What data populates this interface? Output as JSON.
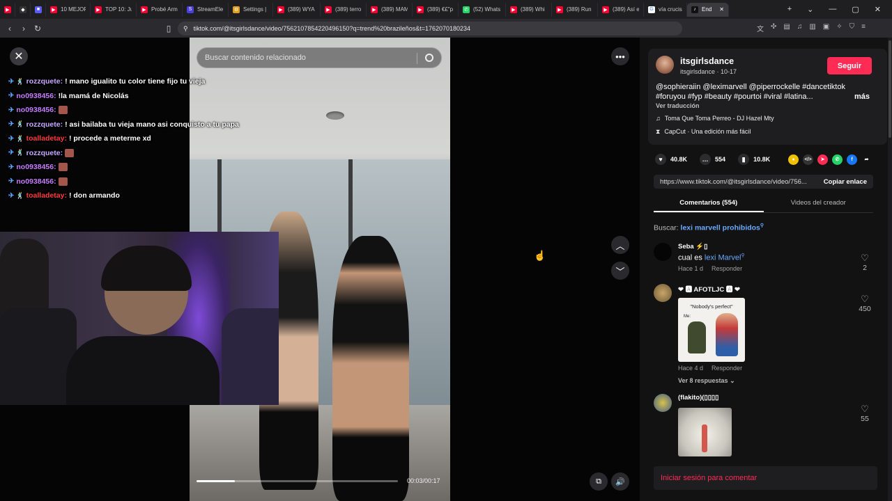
{
  "tabs": [
    {
      "title": "",
      "color": "#ff0033",
      "glyph": "▶"
    },
    {
      "title": "",
      "color": "#333333",
      "glyph": "◆"
    },
    {
      "title": "",
      "color": "#5b5bff",
      "glyph": "■"
    },
    {
      "title": "10 MEJOR",
      "color": "#ff0033",
      "glyph": "▶"
    },
    {
      "title": "TOP 10: Ju",
      "color": "#ff0033",
      "glyph": "▶"
    },
    {
      "title": "Probé Arm",
      "color": "#ff0033",
      "glyph": "▶"
    },
    {
      "title": "StreamEle",
      "color": "#4b3fe0",
      "glyph": "S"
    },
    {
      "title": "Settings |",
      "color": "#e0a020",
      "glyph": "⚙"
    },
    {
      "title": "(389) WYA",
      "color": "#ff0033",
      "glyph": "▶"
    },
    {
      "title": "(389) terro",
      "color": "#ff0033",
      "glyph": "▶"
    },
    {
      "title": "(389) MAM",
      "color": "#ff0033",
      "glyph": "▶"
    },
    {
      "title": "(389) €£\"p",
      "color": "#ff0033",
      "glyph": "▶"
    },
    {
      "title": "(52) Whats",
      "color": "#25d366",
      "glyph": "✆"
    },
    {
      "title": "(389) Whi",
      "color": "#ff0033",
      "glyph": "▶"
    },
    {
      "title": "(389) Run",
      "color": "#ff0033",
      "glyph": "▶"
    },
    {
      "title": "(389) Así e",
      "color": "#ff0033",
      "glyph": "▶"
    },
    {
      "title": "vía crucis",
      "color": "#ffffff",
      "glyph": "G"
    },
    {
      "title": "End",
      "color": "#111111",
      "glyph": "♪",
      "active": true
    }
  ],
  "address": {
    "url": "tiktok.com/@itsgirlsdance/video/7562107854220496150?q=trend%20brazileños&t=1762070180234"
  },
  "video": {
    "search_placeholder": "Buscar contenido relacionado",
    "time": "00:03/00:17",
    "progress": 0.19
  },
  "chat": [
    {
      "user": "rozzquete:",
      "color": "#c9a8ff",
      "msg": "! mano igualito tu color tiene fijo tu vieja",
      "dance": true
    },
    {
      "user": "no0938456:",
      "color": "#c77dff",
      "msg": "!la mamá de Nicolás",
      "dance": false
    },
    {
      "user": "no0938456:",
      "color": "#c77dff",
      "msg": "",
      "emote": true,
      "dance": false
    },
    {
      "user": "rozzquete:",
      "color": "#c9a8ff",
      "msg": "! asi bailaba tu vieja mano asi conquisto a tu papa",
      "dance": true
    },
    {
      "user": "toalladetay:",
      "color": "#ff3b3b",
      "msg": "! procede a meterme xd",
      "dance": true
    },
    {
      "user": "rozzquete:",
      "color": "#c9a8ff",
      "msg": "",
      "emote": true,
      "dance": true
    },
    {
      "user": "no0938456:",
      "color": "#c77dff",
      "msg": "",
      "emote": true,
      "dance": false
    },
    {
      "user": "no0938456:",
      "color": "#c77dff",
      "msg": "",
      "emote": true,
      "dance": false
    },
    {
      "user": "toalladetay:",
      "color": "#ff3b3b",
      "msg": "! don armando",
      "dance": true
    }
  ],
  "author": {
    "name": "itsgirlsdance",
    "sub": "itsgirlsdance · 10-17",
    "follow": "Seguir",
    "description": "@sophieraiin @leximarvell @piperrockelle #dancetiktok #foruyou #fyp #beauty #pourtoi #viral #latina...",
    "more": "más",
    "translate": "Ver traducción",
    "music": "Toma Que Toma Perreo - DJ Hazel Mty",
    "capcut": "CapCut · Una edición más fácil"
  },
  "stats": {
    "likes": "40.8K",
    "comments": "554",
    "saves": "10.8K"
  },
  "share_icons": [
    {
      "name": "coin-icon",
      "color": "#f2c200",
      "glyph": "●"
    },
    {
      "name": "embed-icon",
      "color": "#333333",
      "glyph": "</>"
    },
    {
      "name": "send-icon",
      "color": "#fe2c55",
      "glyph": "➤"
    },
    {
      "name": "whatsapp-icon",
      "color": "#25d366",
      "glyph": "✆"
    },
    {
      "name": "facebook-icon",
      "color": "#1877f2",
      "glyph": "f"
    },
    {
      "name": "share-arrow-icon",
      "color": "#121212",
      "glyph": "➦"
    }
  ],
  "link": {
    "url": "https://www.tiktok.com/@itsgirlsdance/video/756...",
    "copy": "Copiar enlace"
  },
  "panel_tabs": {
    "comments": "Comentarios (554)",
    "creator": "Videos del creador"
  },
  "search_suggestion": {
    "prefix": "Buscar:",
    "query": "lexi marvell prohibidos"
  },
  "comments": [
    {
      "name": "Seba ⚡▯",
      "text_pre": "cual es",
      "text_q": "lexi Marvel",
      "time": "Hace 1 d",
      "reply": "Responder",
      "likes": "2"
    },
    {
      "name": "❤ 🅰 AFOTLJC 🅰 ❤",
      "image_caption": "\"Nobody's perfect\"",
      "image_sub": "Me:",
      "time": "Hace 4 d",
      "reply": "Responder",
      "replies": "Ver 8 respuestas",
      "likes": "450"
    },
    {
      "name": "(flakito)(▯▯▯▯",
      "likes": "55"
    }
  ],
  "login": "Iniciar sesión para comentar",
  "colors": {
    "accent": "#fe2c55",
    "link": "#6aa9ff"
  }
}
